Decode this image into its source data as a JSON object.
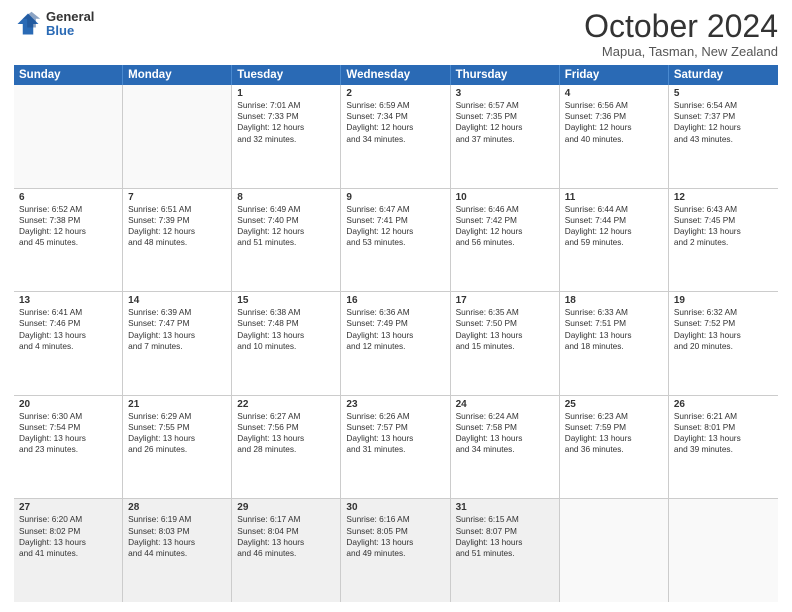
{
  "header": {
    "logo": {
      "general": "General",
      "blue": "Blue"
    },
    "title": "October 2024",
    "location": "Mapua, Tasman, New Zealand"
  },
  "weekdays": [
    "Sunday",
    "Monday",
    "Tuesday",
    "Wednesday",
    "Thursday",
    "Friday",
    "Saturday"
  ],
  "weeks": [
    [
      {
        "day": "",
        "lines": [],
        "empty": true
      },
      {
        "day": "",
        "lines": [],
        "empty": true
      },
      {
        "day": "1",
        "lines": [
          "Sunrise: 7:01 AM",
          "Sunset: 7:33 PM",
          "Daylight: 12 hours",
          "and 32 minutes."
        ]
      },
      {
        "day": "2",
        "lines": [
          "Sunrise: 6:59 AM",
          "Sunset: 7:34 PM",
          "Daylight: 12 hours",
          "and 34 minutes."
        ]
      },
      {
        "day": "3",
        "lines": [
          "Sunrise: 6:57 AM",
          "Sunset: 7:35 PM",
          "Daylight: 12 hours",
          "and 37 minutes."
        ]
      },
      {
        "day": "4",
        "lines": [
          "Sunrise: 6:56 AM",
          "Sunset: 7:36 PM",
          "Daylight: 12 hours",
          "and 40 minutes."
        ]
      },
      {
        "day": "5",
        "lines": [
          "Sunrise: 6:54 AM",
          "Sunset: 7:37 PM",
          "Daylight: 12 hours",
          "and 43 minutes."
        ]
      }
    ],
    [
      {
        "day": "6",
        "lines": [
          "Sunrise: 6:52 AM",
          "Sunset: 7:38 PM",
          "Daylight: 12 hours",
          "and 45 minutes."
        ]
      },
      {
        "day": "7",
        "lines": [
          "Sunrise: 6:51 AM",
          "Sunset: 7:39 PM",
          "Daylight: 12 hours",
          "and 48 minutes."
        ]
      },
      {
        "day": "8",
        "lines": [
          "Sunrise: 6:49 AM",
          "Sunset: 7:40 PM",
          "Daylight: 12 hours",
          "and 51 minutes."
        ]
      },
      {
        "day": "9",
        "lines": [
          "Sunrise: 6:47 AM",
          "Sunset: 7:41 PM",
          "Daylight: 12 hours",
          "and 53 minutes."
        ]
      },
      {
        "day": "10",
        "lines": [
          "Sunrise: 6:46 AM",
          "Sunset: 7:42 PM",
          "Daylight: 12 hours",
          "and 56 minutes."
        ]
      },
      {
        "day": "11",
        "lines": [
          "Sunrise: 6:44 AM",
          "Sunset: 7:44 PM",
          "Daylight: 12 hours",
          "and 59 minutes."
        ]
      },
      {
        "day": "12",
        "lines": [
          "Sunrise: 6:43 AM",
          "Sunset: 7:45 PM",
          "Daylight: 13 hours",
          "and 2 minutes."
        ]
      }
    ],
    [
      {
        "day": "13",
        "lines": [
          "Sunrise: 6:41 AM",
          "Sunset: 7:46 PM",
          "Daylight: 13 hours",
          "and 4 minutes."
        ]
      },
      {
        "day": "14",
        "lines": [
          "Sunrise: 6:39 AM",
          "Sunset: 7:47 PM",
          "Daylight: 13 hours",
          "and 7 minutes."
        ]
      },
      {
        "day": "15",
        "lines": [
          "Sunrise: 6:38 AM",
          "Sunset: 7:48 PM",
          "Daylight: 13 hours",
          "and 10 minutes."
        ]
      },
      {
        "day": "16",
        "lines": [
          "Sunrise: 6:36 AM",
          "Sunset: 7:49 PM",
          "Daylight: 13 hours",
          "and 12 minutes."
        ]
      },
      {
        "day": "17",
        "lines": [
          "Sunrise: 6:35 AM",
          "Sunset: 7:50 PM",
          "Daylight: 13 hours",
          "and 15 minutes."
        ]
      },
      {
        "day": "18",
        "lines": [
          "Sunrise: 6:33 AM",
          "Sunset: 7:51 PM",
          "Daylight: 13 hours",
          "and 18 minutes."
        ]
      },
      {
        "day": "19",
        "lines": [
          "Sunrise: 6:32 AM",
          "Sunset: 7:52 PM",
          "Daylight: 13 hours",
          "and 20 minutes."
        ]
      }
    ],
    [
      {
        "day": "20",
        "lines": [
          "Sunrise: 6:30 AM",
          "Sunset: 7:54 PM",
          "Daylight: 13 hours",
          "and 23 minutes."
        ]
      },
      {
        "day": "21",
        "lines": [
          "Sunrise: 6:29 AM",
          "Sunset: 7:55 PM",
          "Daylight: 13 hours",
          "and 26 minutes."
        ]
      },
      {
        "day": "22",
        "lines": [
          "Sunrise: 6:27 AM",
          "Sunset: 7:56 PM",
          "Daylight: 13 hours",
          "and 28 minutes."
        ]
      },
      {
        "day": "23",
        "lines": [
          "Sunrise: 6:26 AM",
          "Sunset: 7:57 PM",
          "Daylight: 13 hours",
          "and 31 minutes."
        ]
      },
      {
        "day": "24",
        "lines": [
          "Sunrise: 6:24 AM",
          "Sunset: 7:58 PM",
          "Daylight: 13 hours",
          "and 34 minutes."
        ]
      },
      {
        "day": "25",
        "lines": [
          "Sunrise: 6:23 AM",
          "Sunset: 7:59 PM",
          "Daylight: 13 hours",
          "and 36 minutes."
        ]
      },
      {
        "day": "26",
        "lines": [
          "Sunrise: 6:21 AM",
          "Sunset: 8:01 PM",
          "Daylight: 13 hours",
          "and 39 minutes."
        ]
      }
    ],
    [
      {
        "day": "27",
        "lines": [
          "Sunrise: 6:20 AM",
          "Sunset: 8:02 PM",
          "Daylight: 13 hours",
          "and 41 minutes."
        ]
      },
      {
        "day": "28",
        "lines": [
          "Sunrise: 6:19 AM",
          "Sunset: 8:03 PM",
          "Daylight: 13 hours",
          "and 44 minutes."
        ]
      },
      {
        "day": "29",
        "lines": [
          "Sunrise: 6:17 AM",
          "Sunset: 8:04 PM",
          "Daylight: 13 hours",
          "and 46 minutes."
        ]
      },
      {
        "day": "30",
        "lines": [
          "Sunrise: 6:16 AM",
          "Sunset: 8:05 PM",
          "Daylight: 13 hours",
          "and 49 minutes."
        ]
      },
      {
        "day": "31",
        "lines": [
          "Sunrise: 6:15 AM",
          "Sunset: 8:07 PM",
          "Daylight: 13 hours",
          "and 51 minutes."
        ]
      },
      {
        "day": "",
        "lines": [],
        "empty": true
      },
      {
        "day": "",
        "lines": [],
        "empty": true
      }
    ]
  ]
}
